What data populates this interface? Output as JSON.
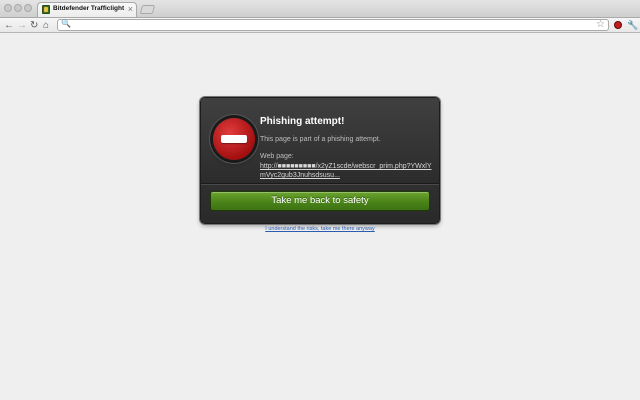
{
  "browser": {
    "tab": {
      "title": "Bitdefender Trafficlight",
      "close": "×"
    },
    "toolbar": {
      "back": "←",
      "forward": "→",
      "reload": "↻",
      "home": "⌂",
      "search_glyph": "🔍",
      "url": "",
      "star": "☆",
      "wrench": "🔧"
    }
  },
  "dialog": {
    "title": "Phishing attempt!",
    "message": "This page is part of a phishing attempt.",
    "url_label": "Web page:",
    "url": "http://■■■■■■■■■/x2yZ1scde/webscr_prim.php?YWxlYmVyc2gub3Jnuhsdsusu...",
    "safety_button": "Take me back to safety",
    "proceed_link": "I understand the risks, take me there anyway"
  },
  "colors": {
    "page_bg": "#efefef",
    "dialog_bg": "#2f2f2f",
    "button_green": "#4a8419",
    "stop_red": "#c81b1b",
    "link_blue": "#2a5db0"
  }
}
